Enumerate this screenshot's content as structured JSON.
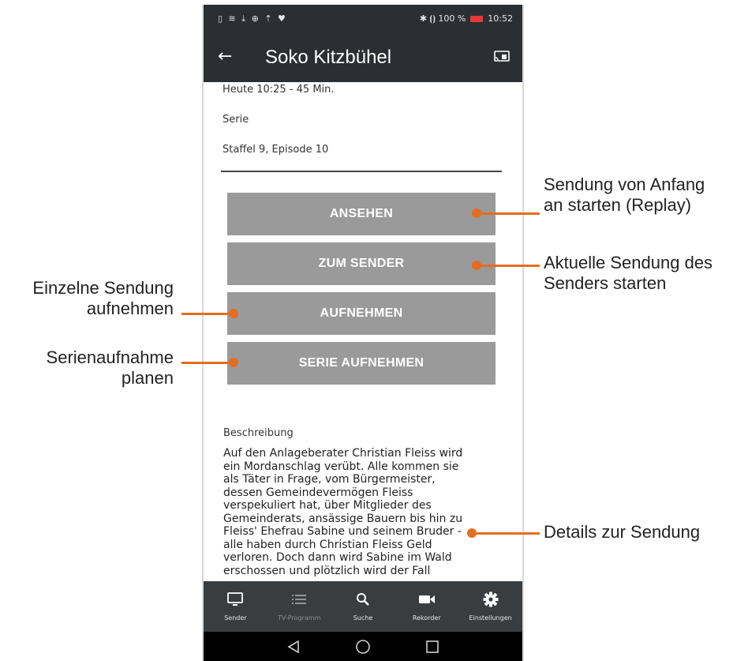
{
  "statusbar": {
    "left_icons": "▯ ≋ ⤓ ⊕ ⇡ ♥",
    "right_text": "✱ ⦗⦘ 100 %",
    "time": "10:52",
    "battery_color": "#e23a3a"
  },
  "appbar": {
    "back_icon": "←",
    "title": "Soko Kitzbühel"
  },
  "meta": {
    "line1": "Heute 10:25   - 45 Min.",
    "line2": "Serie",
    "line3": "Staffel 9, Episode 10"
  },
  "buttons": {
    "watch": "ANSEHEN",
    "to_channel": "ZUM SENDER",
    "record": "AUFNEHMEN",
    "record_series": "SERIE AUFNEHMEN"
  },
  "description": {
    "label": "Beschreibung",
    "text": "Auf den Anlageberater Christian Fleiss wird ein Mordanschlag verübt. Alle kommen sie als Täter in Frage, vom Bürgermeister, dessen Gemeindevermögen Fleiss verspekuliert hat, über Mitglieder des Gemeinderats, ansässige Bauern bis hin zu Fleiss' Ehefrau Sabine und seinem Bruder - alle haben durch Christian Fleiss Geld verloren. Doch dann wird Sabine im Wald erschossen und plötzlich wird der Fall"
  },
  "bottom_nav": [
    {
      "label": "Sender",
      "icon": "tv-icon"
    },
    {
      "label": "TV-Programm",
      "icon": "list-icon"
    },
    {
      "label": "Suche",
      "icon": "search-icon"
    },
    {
      "label": "Rekorder",
      "icon": "camera-icon"
    },
    {
      "label": "Einstellungen",
      "icon": "gear-icon"
    }
  ],
  "annotations": {
    "replay_line1": "Sendung von Anfang",
    "replay_line2": "an starten (Replay)",
    "channel_line1": "Aktuelle Sendung des",
    "channel_line2": "Senders starten",
    "single_line1": "Einzelne Sendung",
    "single_line2": "aufnehmen",
    "series_line1": "Serienaufnahme",
    "series_line2": "planen",
    "details": "Details zur Sendung"
  },
  "colors": {
    "accent": "#e56d1f",
    "bar": "#2b2f33",
    "button": "#9a9a9a",
    "nav": "#3a3d40"
  }
}
